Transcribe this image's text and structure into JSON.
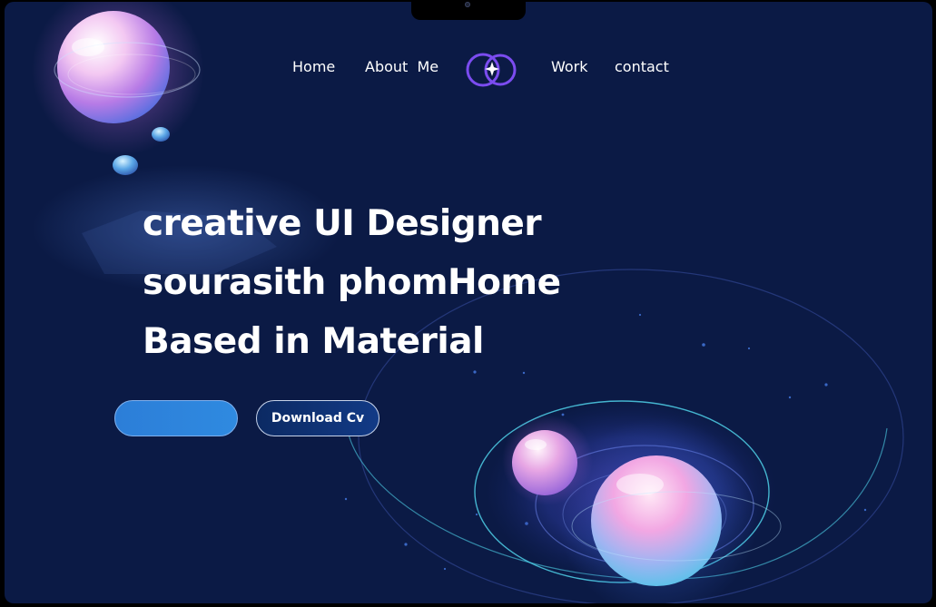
{
  "nav": {
    "items": [
      {
        "label": "Home"
      },
      {
        "label": "About  Me"
      },
      {
        "label": "Work"
      },
      {
        "label": "contact"
      }
    ]
  },
  "logo": {
    "icon": "logo-mark-icon",
    "color": "#7b4cf0"
  },
  "hero": {
    "lines": [
      "creative UI Designer",
      "sourasith phomHome",
      "Based in Material"
    ]
  },
  "buttons": {
    "primary_label": "",
    "download_label": "Download Cv"
  },
  "colors": {
    "background": "#0b1a45",
    "primary_button": "#2c7ed8",
    "orbit": "#4fd0e8"
  }
}
